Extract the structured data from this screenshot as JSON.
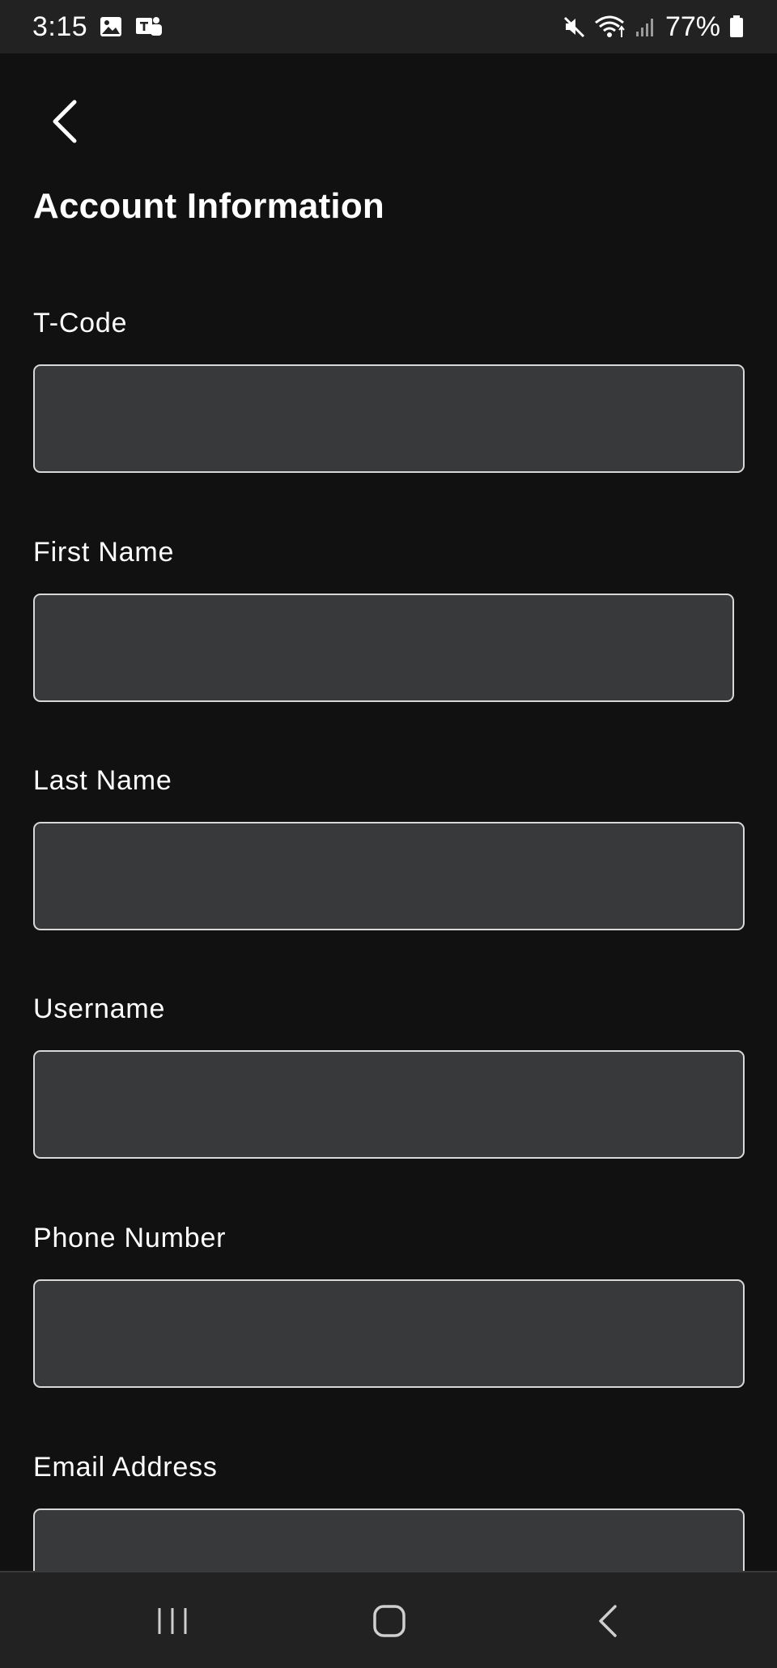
{
  "status_bar": {
    "time": "3:15",
    "battery": "77%",
    "left_icons": [
      "gallery-icon",
      "teams-icon"
    ],
    "right_icons": [
      "mute-icon",
      "wifi-icon",
      "signal-icon",
      "battery-icon"
    ]
  },
  "header": {
    "back_icon": "chevron-left-icon",
    "title": "Account Information"
  },
  "form": {
    "fields": [
      {
        "label": "T-Code",
        "value": "",
        "placeholder": ""
      },
      {
        "label": "First Name",
        "value": "",
        "placeholder": ""
      },
      {
        "label": "Last Name",
        "value": "",
        "placeholder": ""
      },
      {
        "label": "Username",
        "value": "",
        "placeholder": ""
      },
      {
        "label": "Phone Number",
        "value": "",
        "placeholder": ""
      },
      {
        "label": "Email Address",
        "value": "",
        "placeholder": ""
      }
    ]
  },
  "nav_bar": {
    "buttons": [
      "recent-apps-icon",
      "home-icon",
      "back-icon"
    ]
  },
  "colors": {
    "background": "#111111",
    "bars": "#222222",
    "input_fill": "#38393b",
    "input_border": "#d8d8d8",
    "text": "#ffffff"
  }
}
